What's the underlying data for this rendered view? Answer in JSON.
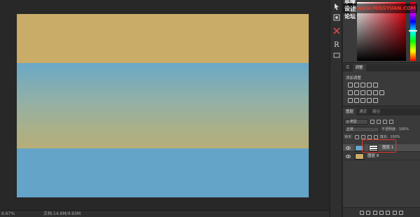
{
  "status": {
    "zoom": "6.67%",
    "doc_info": "文档:14.6M/4.93M"
  },
  "watermark": {
    "cn": "思缘设计论坛",
    "en": "www.MISSYUAN.COM"
  },
  "adjustments": {
    "tabs": [
      "库",
      "调整"
    ],
    "active_tab": "调整",
    "add_label": "添加调整"
  },
  "layers_panel": {
    "tabs": [
      "图层",
      "通道",
      "路径"
    ],
    "filter_kind": "ρ 类型",
    "blend_mode": "正常",
    "opacity_label": "不透明度:",
    "opacity_value": "100%",
    "lock_label": "锁定:",
    "fill_label": "填充:",
    "fill_value": "100%",
    "layers": [
      {
        "name": "图层 1",
        "selected": true,
        "thumb_color": "#64a4c9",
        "has_mask": true
      },
      {
        "name": "图层 0",
        "selected": false,
        "thumb_color": "#c9ac67",
        "has_mask": false
      }
    ]
  },
  "colors": {
    "top_band": "#c9ac67",
    "bottom_band": "#64a4c9",
    "accent_highlight": "#e0362b"
  },
  "icons": {
    "tools": [
      "move-tool-icon",
      "quick-mask-icon",
      "shape-tool-icon",
      "history-brush-icon",
      "paragraph-icon"
    ],
    "footer": [
      "link-layers-icon",
      "fx-icon",
      "add-mask-icon",
      "adjustment-layer-icon",
      "group-icon",
      "new-layer-icon",
      "trash-icon"
    ]
  }
}
